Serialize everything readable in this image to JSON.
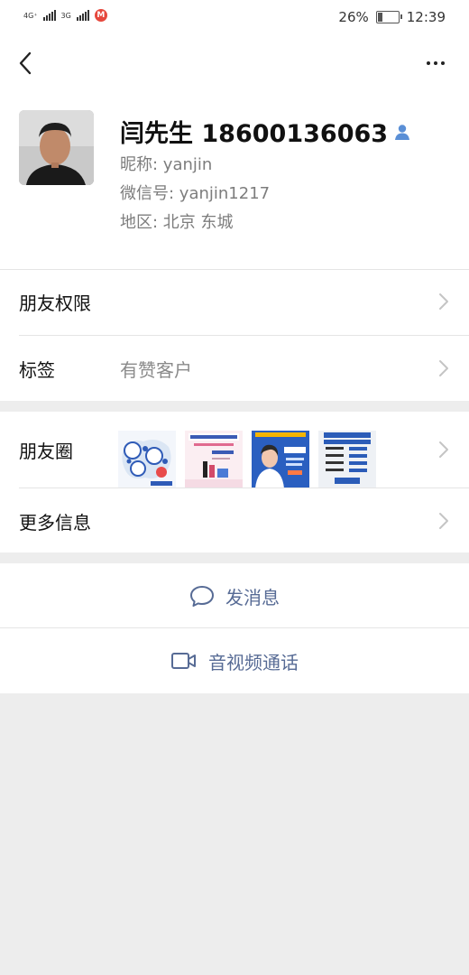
{
  "status_bar": {
    "network1": "4G⁺",
    "network2": "3G",
    "carrier_icon": "M",
    "battery": "26%",
    "battery_level": 0.26,
    "time": "12:39"
  },
  "nav": {
    "back": "back-arrow-icon",
    "more": "more-dots-icon"
  },
  "profile": {
    "name": "闫先生 18600136063",
    "nickname": "昵称: yanjin",
    "wechat_id": "微信号: yanjin1217",
    "region": "地区: 北京 东城"
  },
  "rows": {
    "permissions": "朋友权限",
    "tags_label": "标签",
    "tags_value": "有赞客户",
    "moments": "朋友圈",
    "more_info": "更多信息"
  },
  "moments_thumbs": [
    {
      "caption": ""
    },
    {
      "title": "有赞上门服务"
    },
    {
      "title": "直播时间"
    },
    {
      "time": "11:00-13:30",
      "button": "上课方法"
    }
  ],
  "actions": {
    "message": "发消息",
    "call": "音视频通话"
  },
  "colors": {
    "link": "#576b95",
    "background": "#ededed",
    "accent_icon": "#5a8fd6"
  }
}
